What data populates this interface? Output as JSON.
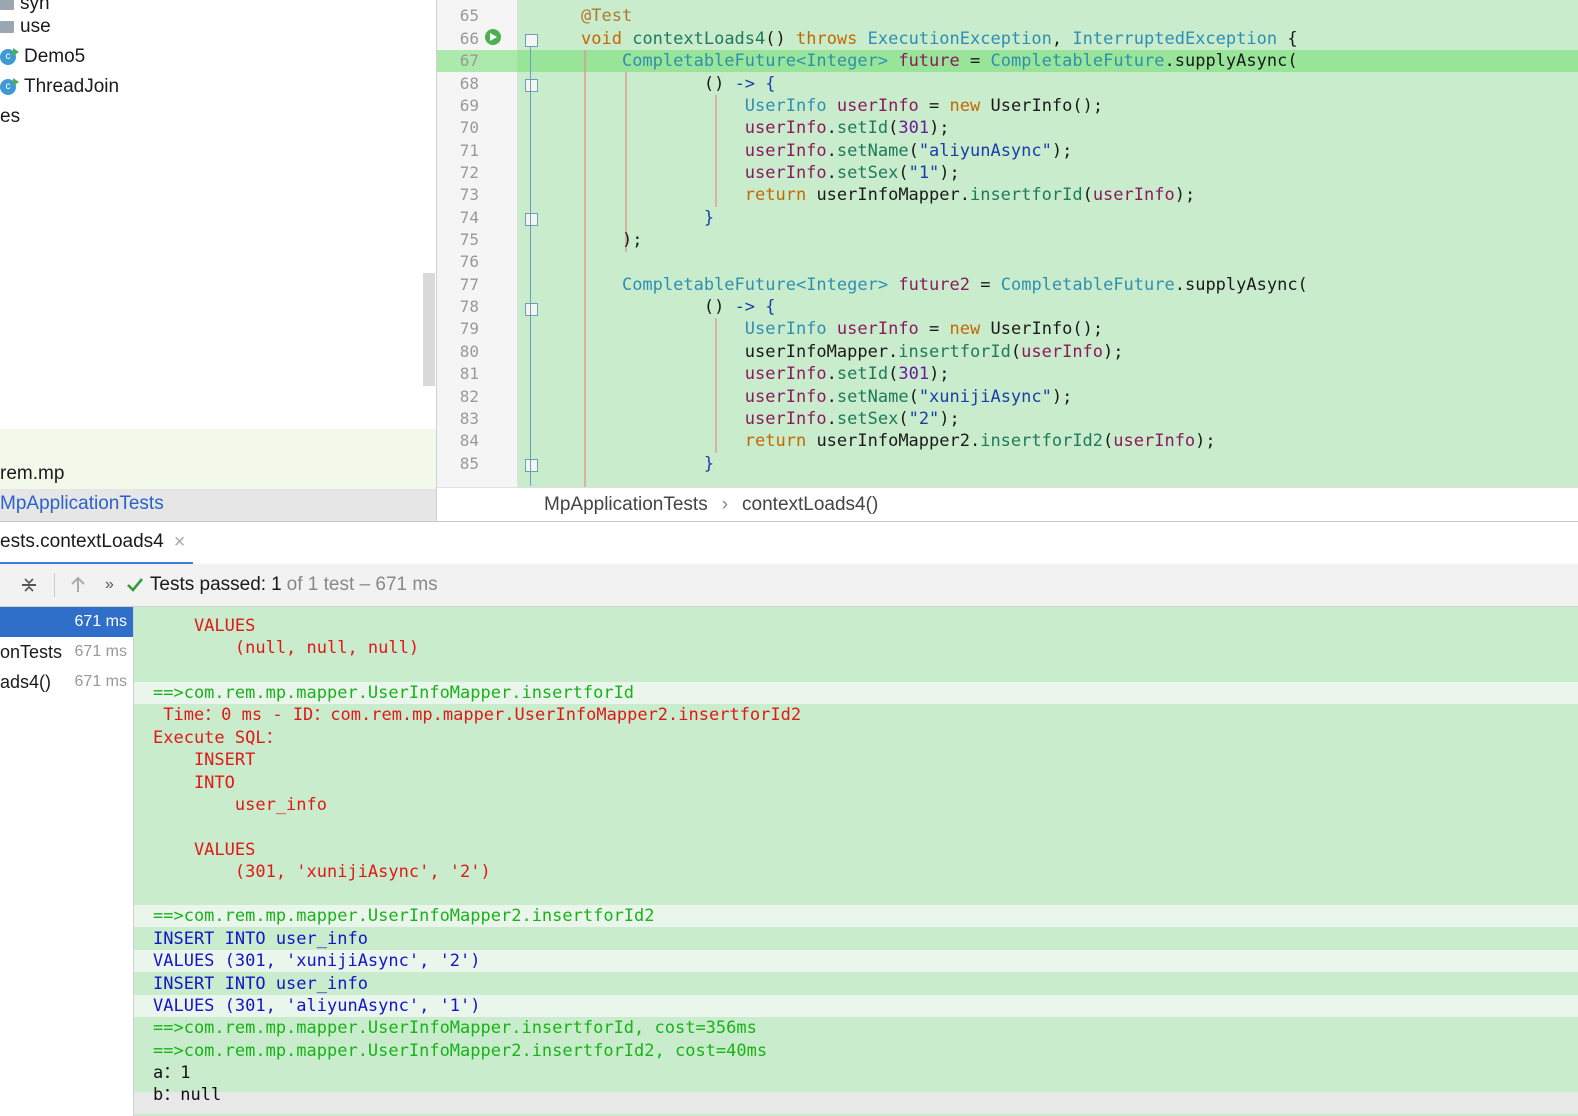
{
  "project": {
    "items": [
      {
        "label": "syn",
        "kind": "folder"
      },
      {
        "label": "use",
        "kind": "folder"
      },
      {
        "label": "Demo5",
        "kind": "class"
      },
      {
        "label": "ThreadJoin",
        "kind": "class"
      },
      {
        "label": "es",
        "kind": "text"
      }
    ],
    "module_label": "rem.mp",
    "selected_file": "MpApplicationTests"
  },
  "editor": {
    "line_numbers": [
      "65",
      "66",
      "67",
      "68",
      "69",
      "70",
      "71",
      "72",
      "73",
      "74",
      "75",
      "76",
      "77",
      "78",
      "79",
      "80",
      "81",
      "82",
      "83",
      "84",
      "85"
    ],
    "highlighted_line": "67"
  },
  "breadcrumb": {
    "class_name": "MpApplicationTests",
    "separator": "›",
    "method_name": "contextLoads4()"
  },
  "run_panel": {
    "tab_label": "ests.contextLoads4",
    "tab_close": "×",
    "status_prefix": "Tests passed:",
    "status_count": "1",
    "status_suffix": "of 1 test – 671 ms",
    "tree": [
      {
        "label": "",
        "time": "671 ms",
        "selected": true
      },
      {
        "label": "onTests",
        "time": "671 ms",
        "selected": false
      },
      {
        "label": "ads4()",
        "time": "671 ms",
        "selected": false
      }
    ]
  },
  "console": {
    "lines": [
      {
        "text": "    VALUES",
        "color": "red"
      },
      {
        "text": "        (null, null, null)",
        "color": "red"
      },
      {
        "text": "",
        "color": "black"
      },
      {
        "text": "==>com.rem.mp.mapper.UserInfoMapper.insertforId",
        "color": "green"
      },
      {
        "text": " Time：0 ms - ID：com.rem.mp.mapper.UserInfoMapper2.insertforId2",
        "color": "red"
      },
      {
        "text": "Execute SQL：",
        "color": "red"
      },
      {
        "text": "    INSERT",
        "color": "red"
      },
      {
        "text": "    INTO",
        "color": "red"
      },
      {
        "text": "        user_info",
        "color": "red"
      },
      {
        "text": "",
        "color": "black"
      },
      {
        "text": "    VALUES",
        "color": "red"
      },
      {
        "text": "        (301, 'xunijiAsync', '2')",
        "color": "red"
      },
      {
        "text": "",
        "color": "black"
      },
      {
        "text": "==>com.rem.mp.mapper.UserInfoMapper2.insertforId2",
        "color": "green"
      },
      {
        "text": "INSERT INTO user_info",
        "color": "blue"
      },
      {
        "text": "VALUES (301, 'xunijiAsync', '2')",
        "color": "blue"
      },
      {
        "text": "INSERT INTO user_info",
        "color": "blue"
      },
      {
        "text": "VALUES (301, 'aliyunAsync', '1')",
        "color": "blue"
      },
      {
        "text": "==>com.rem.mp.mapper.UserInfoMapper.insertforId, cost=356ms",
        "color": "green"
      },
      {
        "text": "==>com.rem.mp.mapper.UserInfoMapper2.insertforId2, cost=40ms",
        "color": "green"
      },
      {
        "text": "a：1",
        "color": "black"
      },
      {
        "text": "b：null",
        "color": "black"
      }
    ]
  },
  "colors": {
    "editor_bg": "#c9eccd",
    "console_red": "#e01818",
    "console_green": "#17b317",
    "console_blue": "#1414c8",
    "accent": "#3b7dd8"
  },
  "icons": {
    "run": "run-gutter-icon",
    "check": "check-icon",
    "up": "arrow-up-icon",
    "more": "chevron-double-right-icon",
    "collapse": "collapse-all-icon"
  }
}
